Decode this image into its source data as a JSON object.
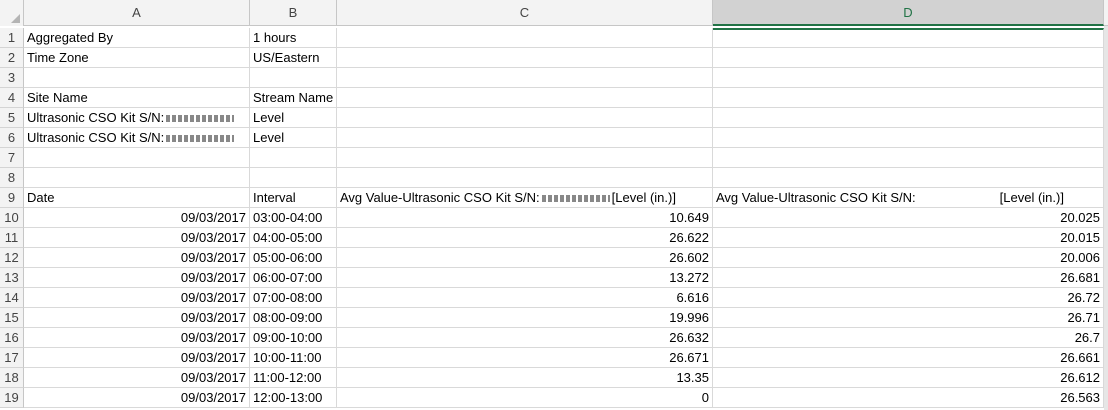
{
  "columns": [
    "A",
    "B",
    "C",
    "D"
  ],
  "rows": [
    {
      "n": "1",
      "a": "Aggregated By",
      "b": "1 hours",
      "c": "",
      "d": ""
    },
    {
      "n": "2",
      "a": "Time Zone",
      "b": "US/Eastern",
      "c": "",
      "d": ""
    },
    {
      "n": "3",
      "a": "",
      "b": "",
      "c": "",
      "d": ""
    },
    {
      "n": "4",
      "a": "Site Name",
      "b": "Stream Name",
      "c": "",
      "d": ""
    },
    {
      "n": "5",
      "a": "Ultrasonic CSO Kit S/N:",
      "b": "Level",
      "c": "",
      "d": ""
    },
    {
      "n": "6",
      "a": "Ultrasonic CSO Kit S/N:",
      "b": "Level",
      "c": "",
      "d": ""
    },
    {
      "n": "7",
      "a": "",
      "b": "",
      "c": "",
      "d": ""
    },
    {
      "n": "8",
      "a": "",
      "b": "",
      "c": "",
      "d": ""
    },
    {
      "n": "9",
      "a": "Date",
      "b": "Interval",
      "c": "Avg Value-Ultrasonic CSO Kit S/N:",
      "c2": "[Level (in.)]",
      "d": "Avg Value-Ultrasonic CSO Kit S/N:",
      "d2": "[Level (in.)]"
    },
    {
      "n": "10",
      "a": "09/03/2017",
      "b": "03:00-04:00",
      "c": "10.649",
      "d": "20.025"
    },
    {
      "n": "11",
      "a": "09/03/2017",
      "b": "04:00-05:00",
      "c": "26.622",
      "d": "20.015"
    },
    {
      "n": "12",
      "a": "09/03/2017",
      "b": "05:00-06:00",
      "c": "26.602",
      "d": "20.006"
    },
    {
      "n": "13",
      "a": "09/03/2017",
      "b": "06:00-07:00",
      "c": "13.272",
      "d": "26.681"
    },
    {
      "n": "14",
      "a": "09/03/2017",
      "b": "07:00-08:00",
      "c": "6.616",
      "d": "26.72"
    },
    {
      "n": "15",
      "a": "09/03/2017",
      "b": "08:00-09:00",
      "c": "19.996",
      "d": "26.71"
    },
    {
      "n": "16",
      "a": "09/03/2017",
      "b": "09:00-10:00",
      "c": "26.632",
      "d": "26.7"
    },
    {
      "n": "17",
      "a": "09/03/2017",
      "b": "10:00-11:00",
      "c": "26.671",
      "d": "26.661"
    },
    {
      "n": "18",
      "a": "09/03/2017",
      "b": "11:00-12:00",
      "c": "13.35",
      "d": "26.612"
    },
    {
      "n": "19",
      "a": "09/03/2017",
      "b": "12:00-13:00",
      "c": "0",
      "d": "26.563"
    }
  ]
}
